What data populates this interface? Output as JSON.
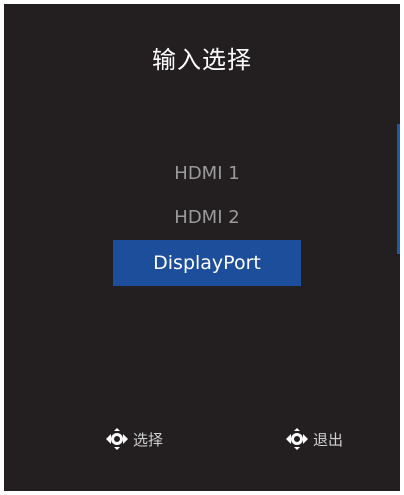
{
  "title": "输入选择",
  "menu": {
    "items": [
      {
        "label": "HDMI 1"
      },
      {
        "label": "HDMI 2"
      },
      {
        "label": "DisplayPort"
      }
    ],
    "selected_index": 2
  },
  "hints": {
    "select_label": "选择",
    "exit_label": "退出",
    "select_icon": "joystick-left-right-icon",
    "exit_icon": "joystick-left-right-icon"
  },
  "colors": {
    "background": "#231f20",
    "selected": "#1c4e9c",
    "scroll_indicator": "#1f5aa6",
    "item_text": "#9a9a9a"
  }
}
